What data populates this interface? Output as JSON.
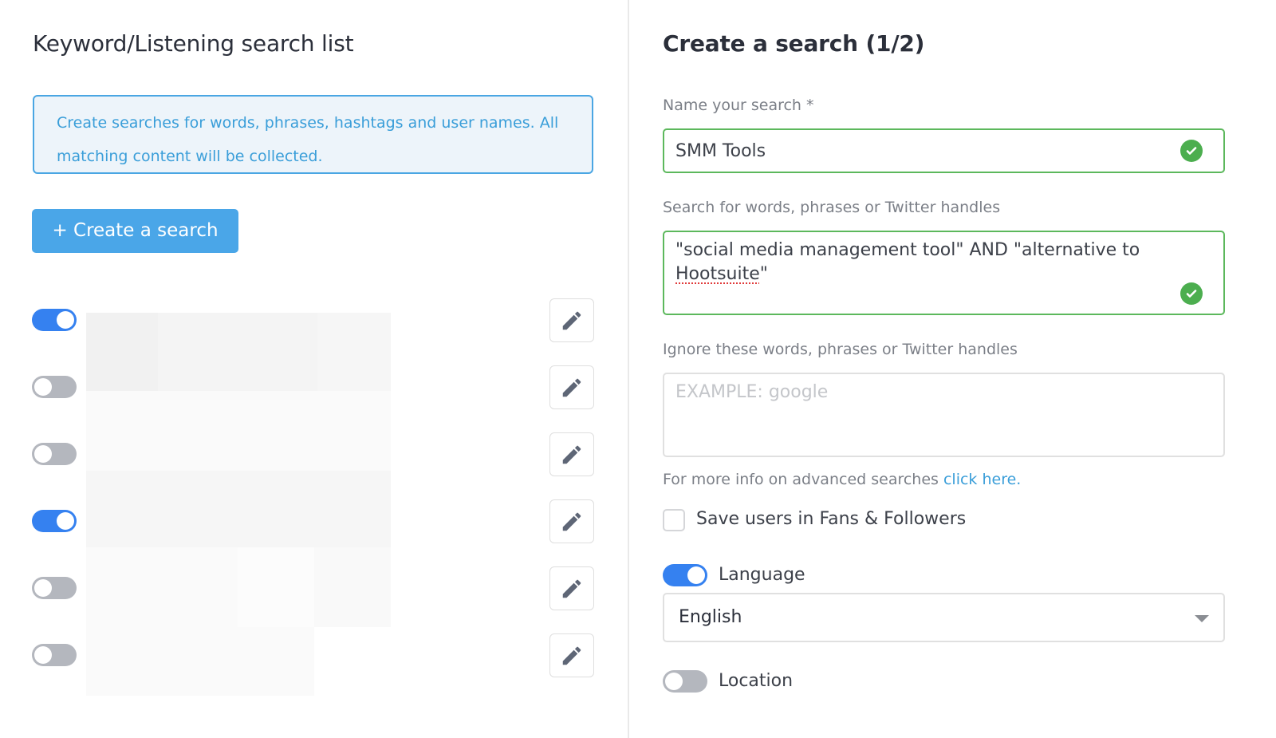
{
  "left": {
    "title": "Keyword/Listening search list",
    "info": "Create searches for words, phrases, hashtags and user names. All matching content will be collected.",
    "create_button": "+ Create a search",
    "searches": [
      {
        "enabled": true
      },
      {
        "enabled": false
      },
      {
        "enabled": false
      },
      {
        "enabled": true
      },
      {
        "enabled": false
      },
      {
        "enabled": false
      }
    ],
    "edit_icon": "pencil-icon",
    "search_names_redacted": true
  },
  "right": {
    "title": "Create a search (1/2)",
    "name_label": "Name your search *",
    "name_value": "SMM Tools",
    "name_valid": true,
    "search_label": "Search for words, phrases or Twitter handles",
    "search_value_part1": "\"social media management tool\" AND \"alternative to",
    "search_value_part2": "Hootsuite",
    "search_value_part3": "\"",
    "search_valid": true,
    "ignore_label": "Ignore these words, phrases or Twitter handles",
    "ignore_placeholder": "EXAMPLE: google",
    "help_text": "For more info on advanced searches ",
    "help_link": "click here.",
    "save_users_label": "Save users in Fans & Followers",
    "save_users_checked": false,
    "language_label": "Language",
    "language_enabled": true,
    "language_value": "English",
    "location_label": "Location",
    "location_enabled": false
  },
  "colors": {
    "accent_blue": "#3581f0",
    "button_blue": "#4aa6e8",
    "info_text": "#3a9ed9",
    "valid_green": "#5cb85c",
    "toggle_off": "#b4b7be"
  }
}
